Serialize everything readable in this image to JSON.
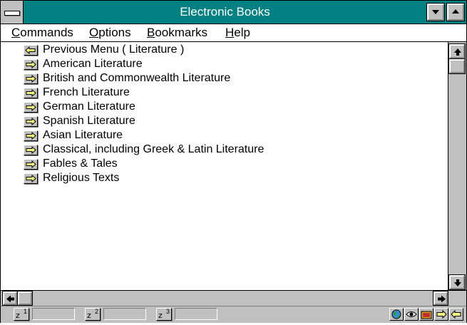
{
  "window": {
    "title": "Electronic Books"
  },
  "menubar": {
    "items": [
      {
        "mnemonic": "C",
        "rest": "ommands"
      },
      {
        "mnemonic": "O",
        "rest": "ptions"
      },
      {
        "mnemonic": "B",
        "rest": "ookmarks"
      },
      {
        "mnemonic": "H",
        "rest": "elp"
      }
    ]
  },
  "list": {
    "items": [
      {
        "label": "Previous Menu ( Literature )",
        "icon": "back-arrow-icon"
      },
      {
        "label": "American Literature",
        "icon": "forward-arrow-icon"
      },
      {
        "label": "British and Commonwealth Literature",
        "icon": "forward-arrow-icon"
      },
      {
        "label": "French Literature",
        "icon": "forward-arrow-icon"
      },
      {
        "label": "German Literature",
        "icon": "forward-arrow-icon"
      },
      {
        "label": "Spanish Literature",
        "icon": "forward-arrow-icon"
      },
      {
        "label": "Asian Literature",
        "icon": "forward-arrow-icon"
      },
      {
        "label": "Classical, including Greek & Latin Literature",
        "icon": "forward-arrow-icon"
      },
      {
        "label": "Fables & Tales",
        "icon": "forward-arrow-icon"
      },
      {
        "label": "Religious Texts",
        "icon": "forward-arrow-icon"
      }
    ]
  },
  "statusbar": {
    "zoom_buttons": [
      {
        "glyph": "z",
        "number": "1"
      },
      {
        "glyph": "z",
        "number": "2"
      },
      {
        "glyph": "z",
        "number": "3"
      }
    ],
    "tools": [
      "globe-icon",
      "eye-icon",
      "folder-icon",
      "forward-arrow-icon",
      "back-arrow-icon"
    ]
  },
  "colors": {
    "titlebar": "#008080",
    "chrome": "#c0c0c0",
    "arrow_fill": "#ffff80"
  }
}
